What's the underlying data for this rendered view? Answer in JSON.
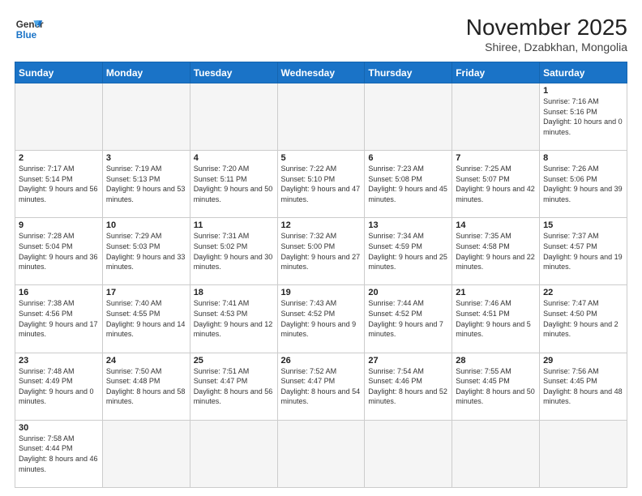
{
  "header": {
    "logo_general": "General",
    "logo_blue": "Blue",
    "month": "November 2025",
    "location": "Shiree, Dzabkhan, Mongolia"
  },
  "weekdays": [
    "Sunday",
    "Monday",
    "Tuesday",
    "Wednesday",
    "Thursday",
    "Friday",
    "Saturday"
  ],
  "weeks": [
    [
      {
        "day": "",
        "empty": true
      },
      {
        "day": "",
        "empty": true
      },
      {
        "day": "",
        "empty": true
      },
      {
        "day": "",
        "empty": true
      },
      {
        "day": "",
        "empty": true
      },
      {
        "day": "",
        "empty": true
      },
      {
        "day": "1",
        "sunrise": "7:16 AM",
        "sunset": "5:16 PM",
        "daylight": "10 hours and 0 minutes."
      }
    ],
    [
      {
        "day": "2",
        "sunrise": "7:17 AM",
        "sunset": "5:14 PM",
        "daylight": "9 hours and 56 minutes."
      },
      {
        "day": "3",
        "sunrise": "7:19 AM",
        "sunset": "5:13 PM",
        "daylight": "9 hours and 53 minutes."
      },
      {
        "day": "4",
        "sunrise": "7:20 AM",
        "sunset": "5:11 PM",
        "daylight": "9 hours and 50 minutes."
      },
      {
        "day": "5",
        "sunrise": "7:22 AM",
        "sunset": "5:10 PM",
        "daylight": "9 hours and 47 minutes."
      },
      {
        "day": "6",
        "sunrise": "7:23 AM",
        "sunset": "5:08 PM",
        "daylight": "9 hours and 45 minutes."
      },
      {
        "day": "7",
        "sunrise": "7:25 AM",
        "sunset": "5:07 PM",
        "daylight": "9 hours and 42 minutes."
      },
      {
        "day": "8",
        "sunrise": "7:26 AM",
        "sunset": "5:06 PM",
        "daylight": "9 hours and 39 minutes."
      }
    ],
    [
      {
        "day": "9",
        "sunrise": "7:28 AM",
        "sunset": "5:04 PM",
        "daylight": "9 hours and 36 minutes."
      },
      {
        "day": "10",
        "sunrise": "7:29 AM",
        "sunset": "5:03 PM",
        "daylight": "9 hours and 33 minutes."
      },
      {
        "day": "11",
        "sunrise": "7:31 AM",
        "sunset": "5:02 PM",
        "daylight": "9 hours and 30 minutes."
      },
      {
        "day": "12",
        "sunrise": "7:32 AM",
        "sunset": "5:00 PM",
        "daylight": "9 hours and 27 minutes."
      },
      {
        "day": "13",
        "sunrise": "7:34 AM",
        "sunset": "4:59 PM",
        "daylight": "9 hours and 25 minutes."
      },
      {
        "day": "14",
        "sunrise": "7:35 AM",
        "sunset": "4:58 PM",
        "daylight": "9 hours and 22 minutes."
      },
      {
        "day": "15",
        "sunrise": "7:37 AM",
        "sunset": "4:57 PM",
        "daylight": "9 hours and 19 minutes."
      }
    ],
    [
      {
        "day": "16",
        "sunrise": "7:38 AM",
        "sunset": "4:56 PM",
        "daylight": "9 hours and 17 minutes."
      },
      {
        "day": "17",
        "sunrise": "7:40 AM",
        "sunset": "4:55 PM",
        "daylight": "9 hours and 14 minutes."
      },
      {
        "day": "18",
        "sunrise": "7:41 AM",
        "sunset": "4:53 PM",
        "daylight": "9 hours and 12 minutes."
      },
      {
        "day": "19",
        "sunrise": "7:43 AM",
        "sunset": "4:52 PM",
        "daylight": "9 hours and 9 minutes."
      },
      {
        "day": "20",
        "sunrise": "7:44 AM",
        "sunset": "4:52 PM",
        "daylight": "9 hours and 7 minutes."
      },
      {
        "day": "21",
        "sunrise": "7:46 AM",
        "sunset": "4:51 PM",
        "daylight": "9 hours and 5 minutes."
      },
      {
        "day": "22",
        "sunrise": "7:47 AM",
        "sunset": "4:50 PM",
        "daylight": "9 hours and 2 minutes."
      }
    ],
    [
      {
        "day": "23",
        "sunrise": "7:48 AM",
        "sunset": "4:49 PM",
        "daylight": "9 hours and 0 minutes."
      },
      {
        "day": "24",
        "sunrise": "7:50 AM",
        "sunset": "4:48 PM",
        "daylight": "8 hours and 58 minutes."
      },
      {
        "day": "25",
        "sunrise": "7:51 AM",
        "sunset": "4:47 PM",
        "daylight": "8 hours and 56 minutes."
      },
      {
        "day": "26",
        "sunrise": "7:52 AM",
        "sunset": "4:47 PM",
        "daylight": "8 hours and 54 minutes."
      },
      {
        "day": "27",
        "sunrise": "7:54 AM",
        "sunset": "4:46 PM",
        "daylight": "8 hours and 52 minutes."
      },
      {
        "day": "28",
        "sunrise": "7:55 AM",
        "sunset": "4:45 PM",
        "daylight": "8 hours and 50 minutes."
      },
      {
        "day": "29",
        "sunrise": "7:56 AM",
        "sunset": "4:45 PM",
        "daylight": "8 hours and 48 minutes."
      }
    ],
    [
      {
        "day": "30",
        "sunrise": "7:58 AM",
        "sunset": "4:44 PM",
        "daylight": "8 hours and 46 minutes."
      },
      {
        "day": "",
        "empty": true
      },
      {
        "day": "",
        "empty": true
      },
      {
        "day": "",
        "empty": true
      },
      {
        "day": "",
        "empty": true
      },
      {
        "day": "",
        "empty": true
      },
      {
        "day": "",
        "empty": true
      }
    ]
  ]
}
